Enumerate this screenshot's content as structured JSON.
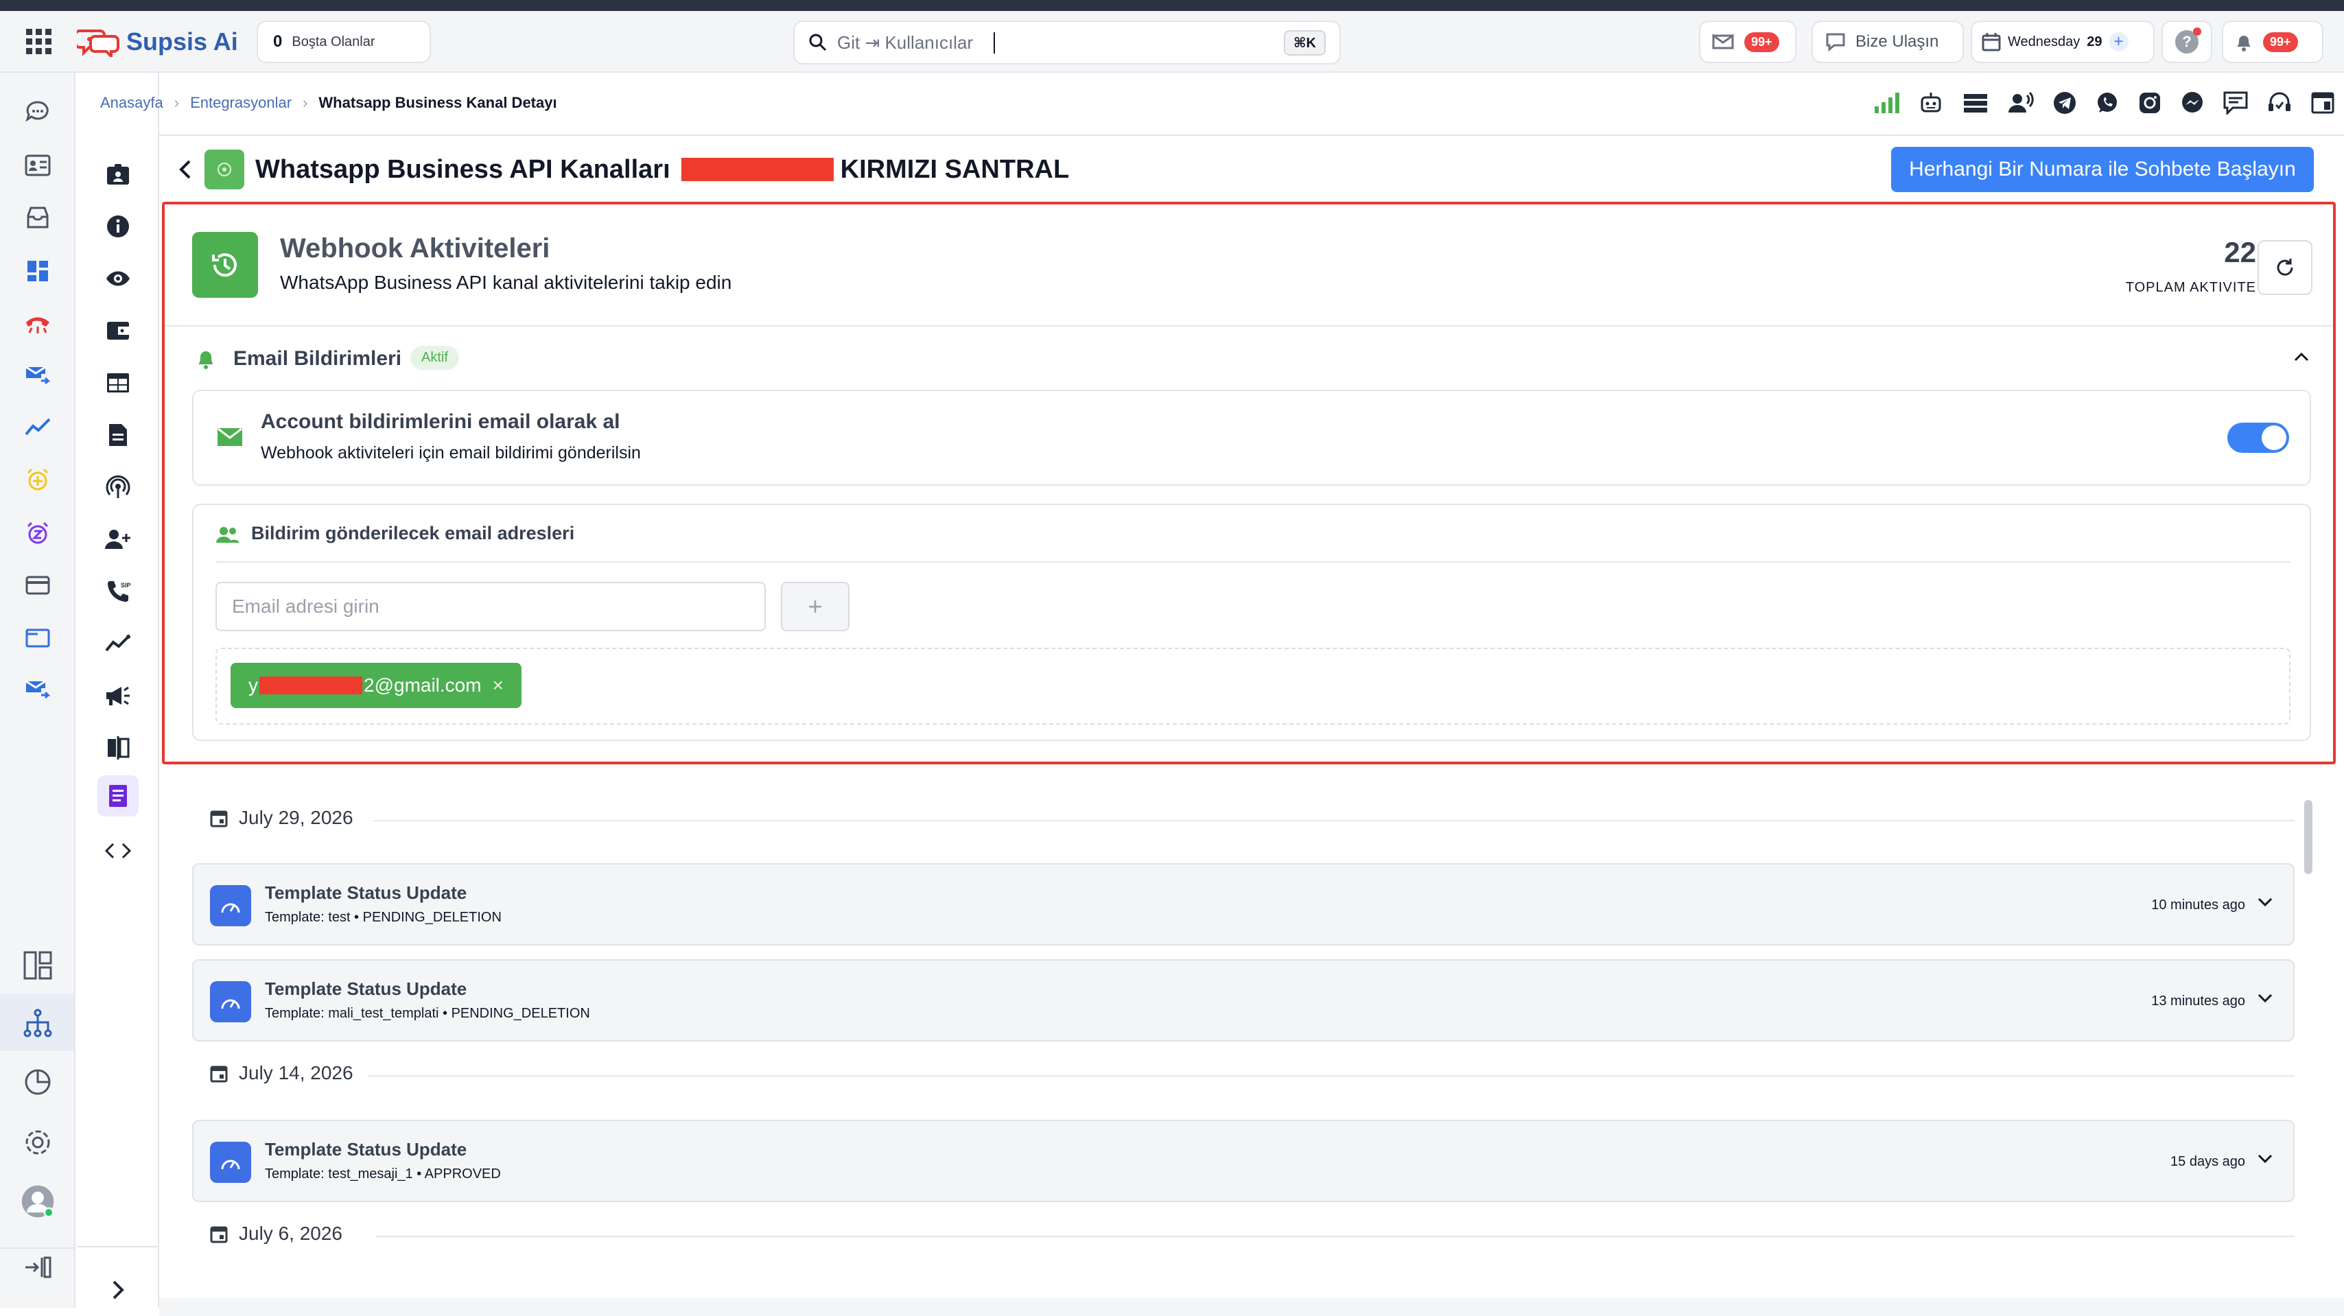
{
  "app": {
    "logo_text": "Supsis Ai",
    "idle_label": "Boşta Olanlar",
    "idle_count": "0"
  },
  "search": {
    "placeholder": "Git ⇥ Kullanıcılar",
    "shortcut": "⌘K"
  },
  "topbar": {
    "messages_badge": "99+",
    "contact_label": "Bize Ulaşın",
    "date_day": "Wednesday",
    "date_num": "29",
    "notifications_badge": "99+",
    "help_icon": "question-icon",
    "colors": {
      "badge": "#ef4444",
      "primary": "#3b82f6",
      "green": "#4caf50",
      "danger_outline": "#e53935"
    }
  },
  "breadcrumbs": {
    "home": "Anasayfa",
    "integrations": "Entegrasyonlar",
    "current": "Whatsapp Business Kanal Detayı"
  },
  "page": {
    "title_prefix": "Whatsapp Business API Kanalları",
    "title_suffix": "KIRMIZI SANTRAL",
    "cta_button": "Herhangi Bir Numara ile Sohbete Başlayın"
  },
  "webhook": {
    "title": "Webhook Aktiviteleri",
    "subtitle": "WhatsApp Business API kanal aktivitelerini takip edin",
    "total_count": "22",
    "total_label": "TOPLAM AKTIVITE"
  },
  "email_notifications": {
    "section_title": "Email Bildirimleri",
    "status_badge": "Aktif",
    "toggle_title": "Account bildirimlerini email olarak al",
    "toggle_desc": "Webhook aktiviteleri için email bildirimi gönderilsin",
    "toggle_on": true,
    "recipients_title": "Bildirim gönderilecek email adresleri",
    "email_placeholder": "Email adresi girin",
    "add_button": "+",
    "recipients": [
      {
        "visible_start": "y",
        "visible_end": "2@gmail.com",
        "remove": "×"
      }
    ]
  },
  "activities": {
    "groups": [
      {
        "date": "July 29, 2026",
        "items": [
          {
            "title": "Template Status Update",
            "detail": "Template: test • PENDING_DELETION",
            "time": "10 minutes ago"
          },
          {
            "title": "Template Status Update",
            "detail": "Template: mali_test_templati • PENDING_DELETION",
            "time": "13 minutes ago"
          }
        ]
      },
      {
        "date": "July 14, 2026",
        "items": [
          {
            "title": "Template Status Update",
            "detail": "Template: test_mesaji_1 • APPROVED",
            "time": "15 days ago"
          }
        ]
      },
      {
        "date": "July 6, 2026",
        "items": []
      }
    ]
  }
}
